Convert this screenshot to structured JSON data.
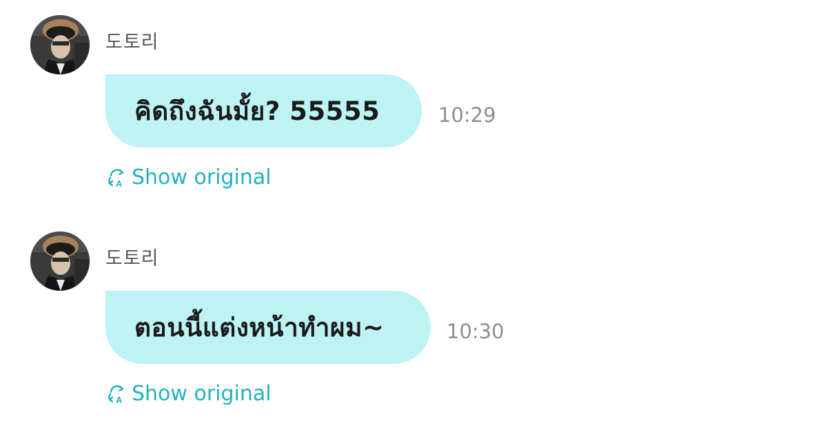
{
  "messages": [
    {
      "sender": "도토리",
      "text": "คิดถึงฉันมั้ย? 55555",
      "time": "10:29",
      "show_original_label": "Show original"
    },
    {
      "sender": "도토리",
      "text": "ตอนนี้แต่งหน้าทำผม~",
      "time": "10:30",
      "show_original_label": "Show original"
    }
  ],
  "icons": {
    "translate": "translate-icon",
    "avatar": "avatar-photo"
  },
  "colors": {
    "bubble": "#bdf3f5",
    "link": "#21b1bd",
    "time": "#8e8e8e",
    "sender": "#555555"
  }
}
